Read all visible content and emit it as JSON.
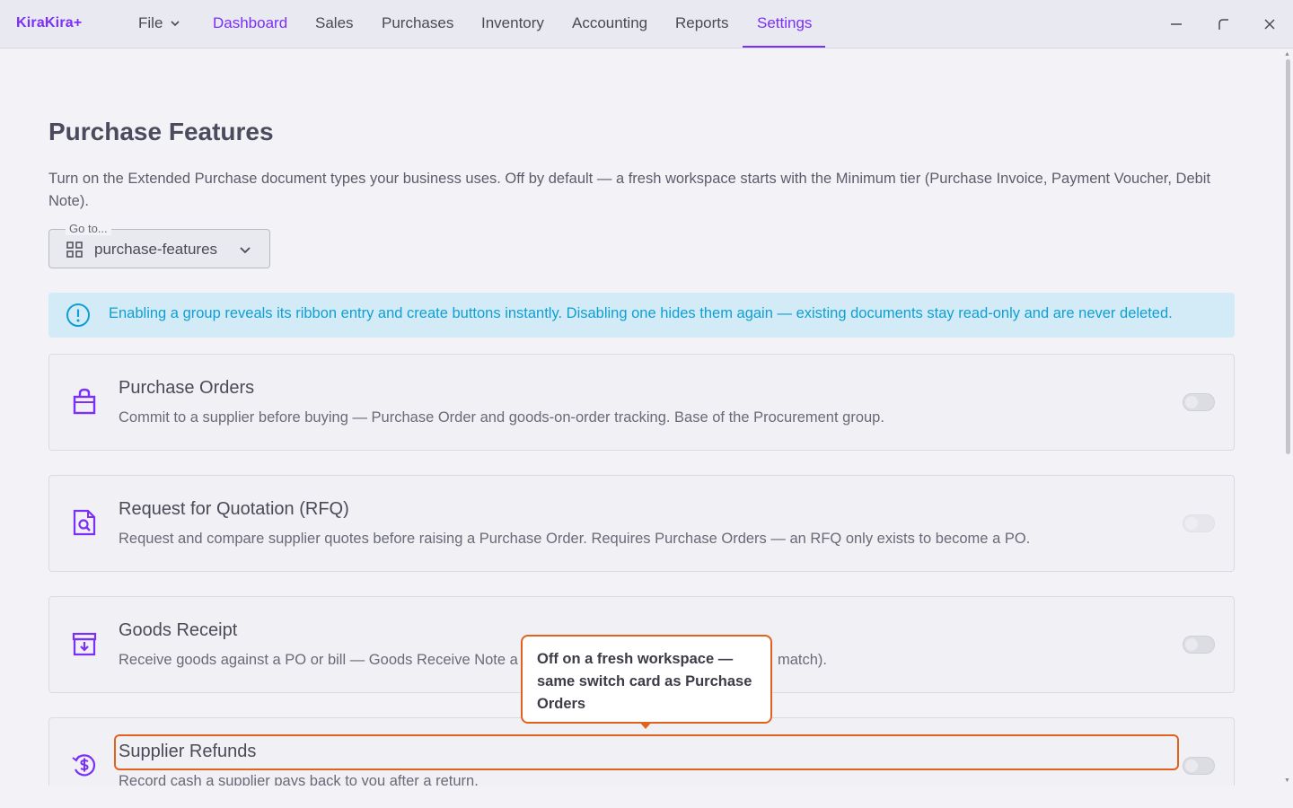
{
  "app": {
    "logo": "KiraKira+"
  },
  "menu": {
    "file": "File",
    "items": [
      "Dashboard",
      "Sales",
      "Purchases",
      "Inventory",
      "Accounting",
      "Reports",
      "Settings"
    ],
    "active": "Settings",
    "accent": "#7b2ff7"
  },
  "window_controls": [
    "minimize-icon",
    "restore-icon",
    "close-icon"
  ],
  "page": {
    "title": "Purchase Features",
    "description": "Turn on the Extended Purchase document types your business uses. Off by default — a fresh workspace starts with the Minimum tier (Purchase Invoice, Payment Voucher, Debit Note)."
  },
  "goto": {
    "label": "Go to...",
    "value": "purchase-features"
  },
  "info_banner": {
    "text": "Enabling a group reveals its ribbon entry and create buttons instantly. Disabling one hides them again — existing documents stay read-only and are never deleted."
  },
  "features": [
    {
      "icon": "shopping-bag-icon",
      "title": "Purchase Orders",
      "description": "Commit to a supplier before buying — Purchase Order and goods-on-order tracking. Base of the Procurement group.",
      "enabled": false,
      "toggle_disabled": false
    },
    {
      "icon": "document-search-icon",
      "title": "Request for Quotation (RFQ)",
      "description": "Request and compare supplier quotes before raising a Purchase Order. Requires Purchase Orders — an RFQ only exists to become a PO.",
      "enabled": false,
      "toggle_disabled": true
    },
    {
      "icon": "inbox-download-icon",
      "title": "Goods Receipt",
      "description_left": "Receive goods against a PO or bill — Goods Receive Note a",
      "description_right": "match).",
      "enabled": false,
      "toggle_disabled": false
    },
    {
      "icon": "refund-dollar-icon",
      "title": "Supplier Refunds",
      "description": "Record cash a supplier pays back to you after a return.",
      "enabled": false,
      "toggle_disabled": false
    }
  ],
  "tooltip": {
    "text": "Off on a fresh workspace — same switch card as Purchase Orders"
  },
  "colors": {
    "highlight": "#e0621d",
    "info_text": "#0f9fd3",
    "info_bg": "#d3ebf6"
  }
}
